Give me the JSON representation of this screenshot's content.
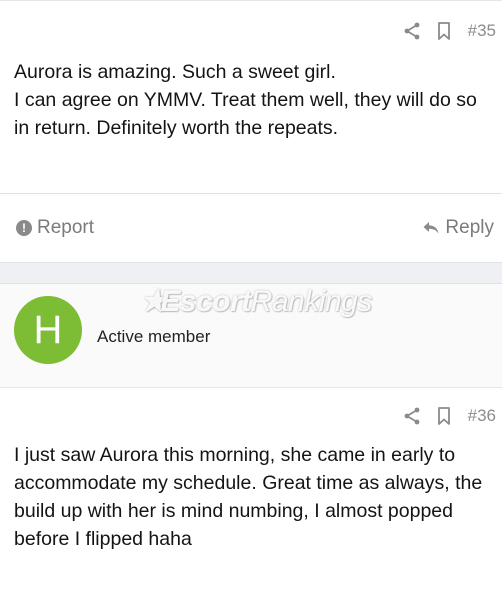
{
  "post35": {
    "number": "#35",
    "lines": [
      "Aurora is amazing. Such a sweet girl.",
      "I can agree on YMMV. Treat them well, they will do so",
      "in return. Definitely worth the repeats."
    ],
    "report_label": "Report",
    "reply_label": "Reply"
  },
  "user": {
    "avatar_letter": "H",
    "title": "Active member",
    "avatar_color": "#7cbd35"
  },
  "watermark": {
    "part1": "Escort",
    "part2": "Rankings"
  },
  "post36": {
    "number": "#36",
    "lines": [
      "I just saw Aurora this morning, she came in early to",
      "accommodate my schedule. Great time as always, the",
      "build up with her is mind numbing, I almost popped",
      "before I flipped haha"
    ]
  },
  "icons": {
    "share": "share-icon",
    "bookmark": "bookmark-icon",
    "report": "report-icon",
    "reply": "reply-icon"
  }
}
